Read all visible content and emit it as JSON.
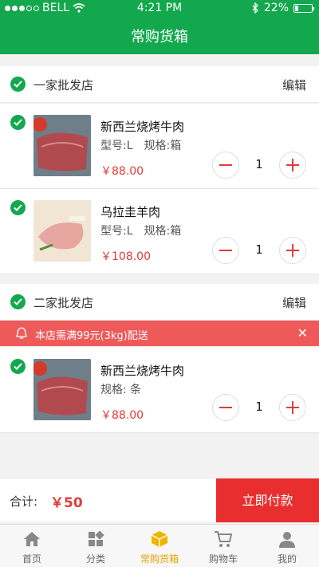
{
  "status_bar": {
    "carrier": "BELL",
    "time": "4:21 PM",
    "battery": "22%",
    "battery_level": 0.22
  },
  "header": {
    "title": "常购货箱"
  },
  "stores": [
    {
      "name": "一家批发店",
      "edit_label": "编辑",
      "items": [
        {
          "name": "新西兰烧烤牛肉",
          "spec": "型号:L　规格:箱",
          "price": "￥88.00",
          "qty": "1"
        },
        {
          "name": "乌拉圭羊肉",
          "spec": "型号:L　规格:箱",
          "price": "￥108.00",
          "qty": "1"
        }
      ]
    },
    {
      "name": "二家批发店",
      "edit_label": "编辑",
      "notice": "本店需满99元(3kg)配送",
      "items": [
        {
          "name": "新西兰烧烤牛肉",
          "spec": "规格: 条",
          "price": "￥88.00",
          "qty": "1"
        }
      ]
    }
  ],
  "footer": {
    "total_label": "合计:",
    "total_amount": "￥50",
    "pay_label": "立即付款"
  },
  "tabs": [
    {
      "label": "首页",
      "icon": "home-icon"
    },
    {
      "label": "分类",
      "icon": "category-icon"
    },
    {
      "label": "常购货箱",
      "icon": "box-icon",
      "active": true
    },
    {
      "label": "购物车",
      "icon": "cart-icon"
    },
    {
      "label": "我的",
      "icon": "user-icon"
    }
  ],
  "colors": {
    "brand_green": "#14a84e",
    "price_red": "#e03b3b",
    "pay_red": "#e82e2e",
    "notice_red": "#ee5a5a",
    "active_tab": "#e8a200"
  }
}
